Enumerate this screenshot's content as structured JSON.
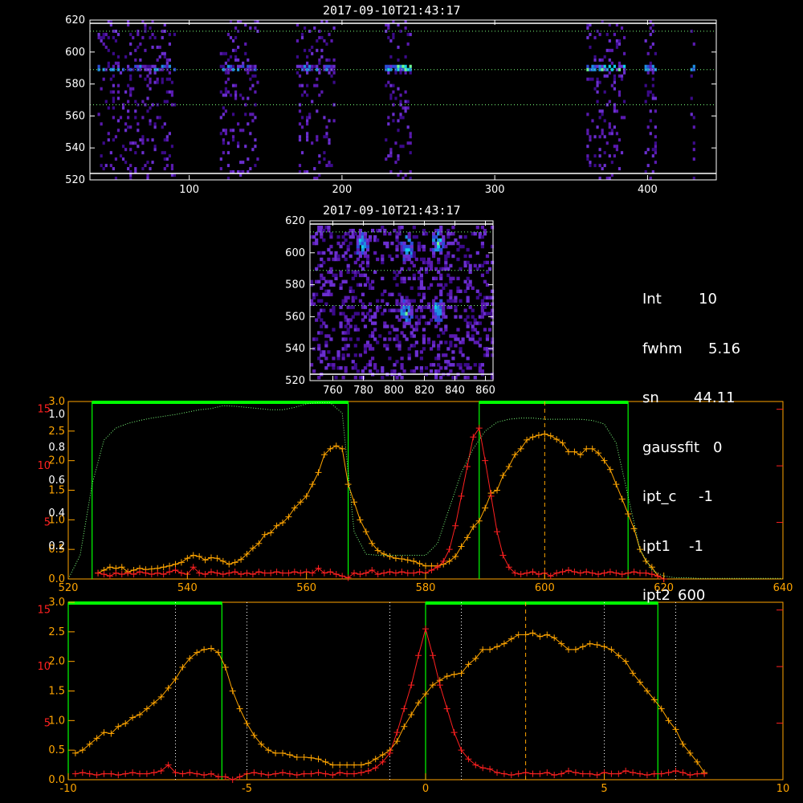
{
  "titles": {
    "top": "2017-09-10T21:43:17",
    "middle": "2017-09-10T21:43:17"
  },
  "info": [
    {
      "key": "Int",
      "value": "10"
    },
    {
      "key": "fwhm",
      "value": "5.16"
    },
    {
      "key": "sn",
      "value": "44.11"
    },
    {
      "key": "gaussfit",
      "value": "0"
    },
    {
      "key": "ipt_c",
      "value": "-1"
    },
    {
      "key": "ipt1",
      "value": "-1"
    },
    {
      "key": "ipt2",
      "value": "600"
    }
  ],
  "colors": {
    "background": "#000000",
    "axes": "#ffffff",
    "orange": "#ffa500",
    "red": "#ff2020",
    "green": "#00ff00",
    "dotted": "#ffffff",
    "dotted_green": "#7cff7c"
  },
  "chart_data": [
    {
      "type": "heatmap",
      "title": "2017-09-10T21:43:17",
      "xlim": [
        35,
        445
      ],
      "ylim": [
        520,
        620
      ],
      "xticks": [
        100,
        200,
        300,
        400
      ],
      "yticks": [
        520,
        540,
        560,
        580,
        600,
        620
      ],
      "hlines": [
        524,
        567,
        589,
        613
      ],
      "bands": [
        [
          40,
          90
        ],
        [
          120,
          145
        ],
        [
          170,
          195
        ],
        [
          228,
          245
        ],
        [
          360,
          385
        ],
        [
          398,
          405
        ],
        [
          428,
          431
        ]
      ],
      "core_row": 589
    },
    {
      "type": "heatmap",
      "title": "2017-09-10T21:43:17",
      "xlim": [
        745,
        865
      ],
      "ylim": [
        520,
        620
      ],
      "xticks": [
        760,
        780,
        800,
        820,
        840,
        860
      ],
      "yticks": [
        520,
        540,
        560,
        580,
        600,
        620
      ],
      "hlines": [
        524,
        567,
        589,
        613
      ],
      "bright_spots": [
        [
          778,
          604
        ],
        [
          808,
          602
        ],
        [
          828,
          606
        ],
        [
          828,
          563
        ],
        [
          807,
          562
        ]
      ]
    },
    {
      "type": "line",
      "xlim": [
        520,
        640
      ],
      "xticks": [
        520,
        540,
        560,
        580,
        600,
        620,
        640
      ],
      "yticks_left": [
        "0.0",
        "0.5",
        "1.0",
        "1.5",
        "2.0",
        "2.5",
        "3.0"
      ],
      "yticks_left2": [
        "0.0",
        "0.2",
        "0.4",
        "0.6",
        "0.8",
        "1.0"
      ],
      "yticks_right_red": [
        "0",
        "5",
        "10",
        "15"
      ],
      "ylim": [
        0,
        3.0
      ],
      "green_windows": [
        [
          524,
          567
        ],
        [
          589,
          614
        ]
      ],
      "dashed_x": 600,
      "series": [
        {
          "color": "orange",
          "x": [
            525,
            526,
            527,
            528,
            529,
            530,
            531,
            532,
            533,
            534,
            535,
            536,
            537,
            538,
            539,
            540,
            541,
            542,
            543,
            544,
            545,
            546,
            547,
            548,
            549,
            550,
            551,
            552,
            553,
            554,
            555,
            556,
            557,
            558,
            559,
            560,
            561,
            562,
            563,
            564,
            565,
            566,
            567,
            568,
            569,
            570,
            571,
            572,
            573,
            574,
            575,
            576,
            577,
            578,
            579,
            580,
            581,
            582,
            583,
            584,
            585,
            586,
            587,
            588,
            589,
            590,
            591,
            592,
            593,
            594,
            595,
            596,
            597,
            598,
            599,
            600,
            601,
            602,
            603,
            604,
            605,
            606,
            607,
            608,
            609,
            610,
            611,
            612,
            613,
            614,
            615,
            616,
            617,
            618,
            619,
            620
          ],
          "y": [
            0.1,
            0.15,
            0.2,
            0.18,
            0.2,
            0.12,
            0.15,
            0.18,
            0.16,
            0.17,
            0.18,
            0.2,
            0.22,
            0.25,
            0.28,
            0.35,
            0.4,
            0.38,
            0.32,
            0.36,
            0.35,
            0.3,
            0.25,
            0.28,
            0.33,
            0.42,
            0.52,
            0.6,
            0.75,
            0.78,
            0.9,
            0.95,
            1.05,
            1.2,
            1.3,
            1.4,
            1.6,
            1.8,
            2.1,
            2.2,
            2.25,
            2.2,
            1.6,
            1.3,
            1.0,
            0.8,
            0.6,
            0.48,
            0.42,
            0.38,
            0.35,
            0.34,
            0.32,
            0.3,
            0.26,
            0.22,
            0.22,
            0.22,
            0.25,
            0.3,
            0.38,
            0.55,
            0.7,
            0.88,
            0.98,
            1.2,
            1.45,
            1.5,
            1.75,
            1.9,
            2.1,
            2.2,
            2.35,
            2.4,
            2.43,
            2.45,
            2.42,
            2.36,
            2.3,
            2.15,
            2.15,
            2.1,
            2.2,
            2.2,
            2.13,
            2.0,
            1.85,
            1.6,
            1.35,
            1.1,
            0.85,
            0.5,
            0.3,
            0.2,
            0.05,
            0.0
          ]
        },
        {
          "color": "red",
          "x": [
            525,
            526,
            527,
            528,
            529,
            530,
            531,
            532,
            533,
            534,
            535,
            536,
            537,
            538,
            539,
            540,
            541,
            542,
            543,
            544,
            545,
            546,
            547,
            548,
            549,
            550,
            551,
            552,
            553,
            554,
            555,
            556,
            557,
            558,
            559,
            560,
            561,
            562,
            563,
            564,
            565,
            566,
            567,
            568,
            569,
            570,
            571,
            572,
            573,
            574,
            575,
            576,
            577,
            578,
            579,
            580,
            581,
            582,
            583,
            584,
            585,
            586,
            587,
            588,
            589,
            590,
            591,
            592,
            593,
            594,
            595,
            596,
            597,
            598,
            599,
            600,
            601,
            602,
            603,
            604,
            605,
            606,
            607,
            608,
            609,
            610,
            611,
            612,
            613,
            614,
            615,
            616,
            617,
            618,
            619,
            620
          ],
          "y": [
            0.1,
            0.08,
            0.05,
            0.1,
            0.08,
            0.1,
            0.08,
            0.12,
            0.1,
            0.08,
            0.1,
            0.08,
            0.12,
            0.15,
            0.1,
            0.08,
            0.2,
            0.1,
            0.08,
            0.12,
            0.1,
            0.08,
            0.1,
            0.12,
            0.08,
            0.1,
            0.08,
            0.12,
            0.1,
            0.1,
            0.12,
            0.1,
            0.1,
            0.12,
            0.1,
            0.12,
            0.1,
            0.18,
            0.1,
            0.12,
            0.08,
            0.05,
            0.02,
            0.1,
            0.08,
            0.1,
            0.15,
            0.08,
            0.1,
            0.12,
            0.1,
            0.12,
            0.1,
            0.1,
            0.12,
            0.1,
            0.15,
            0.2,
            0.3,
            0.5,
            0.9,
            1.4,
            1.9,
            2.4,
            2.55,
            2.0,
            1.4,
            0.8,
            0.4,
            0.2,
            0.1,
            0.08,
            0.1,
            0.12,
            0.08,
            0.1,
            0.05,
            0.1,
            0.12,
            0.15,
            0.12,
            0.1,
            0.12,
            0.1,
            0.08,
            0.1,
            0.12,
            0.1,
            0.08,
            0.1,
            0.12,
            0.1,
            0.1,
            0.08,
            0.05,
            0.0
          ]
        },
        {
          "color": "dotted",
          "x": [
            520,
            522,
            524,
            526,
            528,
            530,
            532,
            534,
            536,
            538,
            540,
            542,
            544,
            546,
            548,
            550,
            552,
            554,
            556,
            558,
            560,
            562,
            564,
            566,
            568,
            570,
            572,
            574,
            576,
            578,
            580,
            582,
            584,
            586,
            588,
            590,
            592,
            594,
            596,
            598,
            600,
            602,
            604,
            606,
            608,
            610,
            612,
            614,
            616,
            618,
            620,
            622,
            624,
            626,
            628,
            630,
            632,
            634,
            636,
            638,
            640
          ],
          "y": [
            0.0,
            0.4,
            1.6,
            2.35,
            2.55,
            2.63,
            2.68,
            2.72,
            2.75,
            2.78,
            2.82,
            2.86,
            2.88,
            2.93,
            2.92,
            2.9,
            2.88,
            2.86,
            2.86,
            2.9,
            2.96,
            2.98,
            2.98,
            2.8,
            0.8,
            0.42,
            0.4,
            0.4,
            0.4,
            0.4,
            0.4,
            0.6,
            1.2,
            1.8,
            2.2,
            2.5,
            2.65,
            2.7,
            2.72,
            2.72,
            2.7,
            2.7,
            2.7,
            2.7,
            2.68,
            2.62,
            2.3,
            1.4,
            0.5,
            0.15,
            0.05,
            0.02,
            0.02,
            0.01,
            0.01,
            0.01,
            0.01,
            0.01,
            0.01,
            0.01,
            0.01
          ]
        }
      ]
    },
    {
      "type": "line",
      "xlim": [
        -10,
        10
      ],
      "xticks": [
        -10,
        -5,
        0,
        5,
        10
      ],
      "yticks_left": [
        "0.0",
        "0.5",
        "1.0",
        "1.5",
        "2.0",
        "2.5",
        "3.0"
      ],
      "yticks_right_red": [
        "0",
        "5",
        "10",
        "15"
      ],
      "ylim": [
        0,
        3.0
      ],
      "green_windows": [
        [
          -10,
          -5.7
        ],
        [
          0,
          6.5
        ]
      ],
      "dashed_x": 2.8,
      "dotted_x": [
        -7,
        -5,
        -1,
        1,
        5,
        7
      ],
      "series": [
        {
          "color": "orange",
          "x": [
            -9.8,
            -9.6,
            -9.4,
            -9.2,
            -9.0,
            -8.8,
            -8.6,
            -8.4,
            -8.2,
            -8.0,
            -7.8,
            -7.6,
            -7.4,
            -7.2,
            -7.0,
            -6.8,
            -6.6,
            -6.4,
            -6.2,
            -6.0,
            -5.8,
            -5.6,
            -5.4,
            -5.2,
            -5.0,
            -4.8,
            -4.6,
            -4.4,
            -4.2,
            -4.0,
            -3.8,
            -3.6,
            -3.4,
            -3.2,
            -3.0,
            -2.8,
            -2.6,
            -2.4,
            -2.2,
            -2.0,
            -1.8,
            -1.6,
            -1.4,
            -1.2,
            -1.0,
            -0.8,
            -0.6,
            -0.4,
            -0.2,
            0.0,
            0.2,
            0.4,
            0.6,
            0.8,
            1.0,
            1.2,
            1.4,
            1.6,
            1.8,
            2.0,
            2.2,
            2.4,
            2.6,
            2.8,
            3.0,
            3.2,
            3.4,
            3.6,
            3.8,
            4.0,
            4.2,
            4.4,
            4.6,
            4.8,
            5.0,
            5.2,
            5.4,
            5.6,
            5.8,
            6.0,
            6.2,
            6.4,
            6.6,
            6.8,
            7.0,
            7.2,
            7.4,
            7.6,
            7.8
          ],
          "y": [
            0.45,
            0.5,
            0.6,
            0.7,
            0.8,
            0.78,
            0.9,
            0.95,
            1.05,
            1.1,
            1.2,
            1.3,
            1.4,
            1.55,
            1.7,
            1.9,
            2.05,
            2.15,
            2.2,
            2.22,
            2.15,
            1.9,
            1.5,
            1.2,
            0.95,
            0.75,
            0.6,
            0.5,
            0.45,
            0.45,
            0.42,
            0.38,
            0.38,
            0.37,
            0.35,
            0.3,
            0.25,
            0.25,
            0.25,
            0.25,
            0.25,
            0.28,
            0.35,
            0.42,
            0.5,
            0.65,
            0.9,
            1.1,
            1.3,
            1.45,
            1.6,
            1.68,
            1.75,
            1.78,
            1.8,
            1.95,
            2.05,
            2.2,
            2.2,
            2.25,
            2.3,
            2.38,
            2.45,
            2.45,
            2.48,
            2.42,
            2.45,
            2.4,
            2.3,
            2.2,
            2.2,
            2.25,
            2.3,
            2.28,
            2.25,
            2.2,
            2.1,
            2.0,
            1.8,
            1.65,
            1.5,
            1.35,
            1.2,
            1.0,
            0.85,
            0.6,
            0.45,
            0.3,
            0.12
          ]
        },
        {
          "color": "red",
          "x": [
            -9.8,
            -9.6,
            -9.4,
            -9.2,
            -9.0,
            -8.8,
            -8.6,
            -8.4,
            -8.2,
            -8.0,
            -7.8,
            -7.6,
            -7.4,
            -7.2,
            -7.0,
            -6.8,
            -6.6,
            -6.4,
            -6.2,
            -6.0,
            -5.8,
            -5.6,
            -5.4,
            -5.2,
            -5.0,
            -4.8,
            -4.6,
            -4.4,
            -4.2,
            -4.0,
            -3.8,
            -3.6,
            -3.4,
            -3.2,
            -3.0,
            -2.8,
            -2.6,
            -2.4,
            -2.2,
            -2.0,
            -1.8,
            -1.6,
            -1.4,
            -1.2,
            -1.0,
            -0.8,
            -0.6,
            -0.4,
            -0.2,
            0.0,
            0.2,
            0.4,
            0.6,
            0.8,
            1.0,
            1.2,
            1.4,
            1.6,
            1.8,
            2.0,
            2.2,
            2.4,
            2.6,
            2.8,
            3.0,
            3.2,
            3.4,
            3.6,
            3.8,
            4.0,
            4.2,
            4.4,
            4.6,
            4.8,
            5.0,
            5.2,
            5.4,
            5.6,
            5.8,
            6.0,
            6.2,
            6.4,
            6.6,
            6.8,
            7.0,
            7.2,
            7.4,
            7.6,
            7.8
          ],
          "y": [
            0.1,
            0.12,
            0.1,
            0.08,
            0.1,
            0.1,
            0.08,
            0.1,
            0.12,
            0.1,
            0.1,
            0.12,
            0.15,
            0.25,
            0.12,
            0.1,
            0.12,
            0.1,
            0.08,
            0.1,
            0.05,
            0.05,
            0.0,
            0.05,
            0.1,
            0.12,
            0.1,
            0.08,
            0.1,
            0.12,
            0.1,
            0.08,
            0.1,
            0.1,
            0.12,
            0.1,
            0.08,
            0.12,
            0.1,
            0.1,
            0.12,
            0.15,
            0.2,
            0.3,
            0.45,
            0.8,
            1.2,
            1.6,
            2.1,
            2.55,
            2.1,
            1.6,
            1.2,
            0.8,
            0.5,
            0.35,
            0.25,
            0.2,
            0.18,
            0.12,
            0.1,
            0.08,
            0.1,
            0.12,
            0.1,
            0.1,
            0.12,
            0.08,
            0.1,
            0.15,
            0.12,
            0.1,
            0.1,
            0.08,
            0.12,
            0.1,
            0.1,
            0.15,
            0.12,
            0.1,
            0.08,
            0.1,
            0.1,
            0.12,
            0.15,
            0.12,
            0.08,
            0.1,
            0.1
          ]
        }
      ]
    }
  ]
}
